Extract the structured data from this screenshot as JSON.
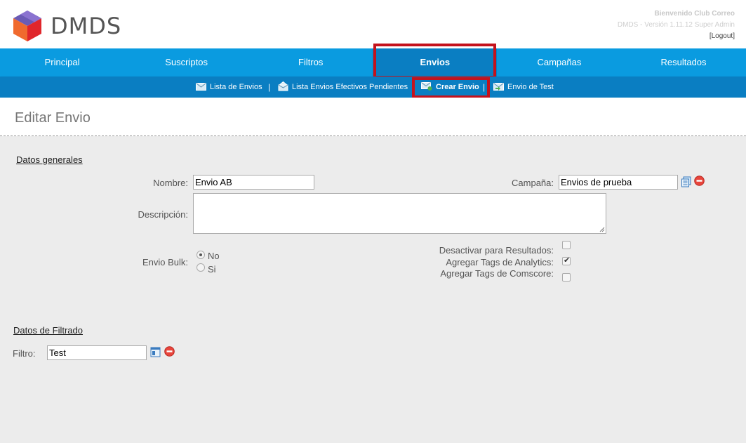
{
  "header": {
    "logo_text": "DMDS",
    "welcome": "Bienvenido Club Correo",
    "version": "DMDS - Versión 1.11.12 Super Admin",
    "logout": "[Logout]"
  },
  "main_nav": {
    "items": [
      {
        "label": "Principal"
      },
      {
        "label": "Suscriptos"
      },
      {
        "label": "Filtros"
      },
      {
        "label": "Envios",
        "active": true
      },
      {
        "label": "Campañas"
      },
      {
        "label": "Resultados"
      }
    ]
  },
  "sub_nav": {
    "items": [
      {
        "label": "Lista de Envios",
        "icon": "envelope-icon"
      },
      {
        "label": "Lista Envios Efectivos Pendientes",
        "icon": "inbox-icon"
      },
      {
        "label": "Crear Envio",
        "icon": "new-envelope-icon",
        "active": true
      },
      {
        "label": "Envio de Test",
        "icon": "test-envelope-icon"
      }
    ],
    "separator": "|"
  },
  "page": {
    "title": "Editar Envio"
  },
  "datos_generales": {
    "section_title": "Datos generales",
    "nombre_label": "Nombre:",
    "nombre_value": "Envio AB",
    "campana_label": "Campaña:",
    "campana_value": "Envios de prueba",
    "descripcion_label": "Descripción:",
    "descripcion_value": "",
    "bulk_label": "Envio Bulk:",
    "bulk_options": [
      {
        "label": "No",
        "checked": true
      },
      {
        "label": "Si",
        "checked": false
      }
    ],
    "checks": [
      {
        "label": "Desactivar para Resultados:",
        "checked": false
      },
      {
        "label": "Agregar Tags de Analytics:",
        "checked": true
      },
      {
        "label": "Agregar Tags de Comscore:",
        "checked": false
      }
    ]
  },
  "datos_filtrado": {
    "section_title": "Datos de Filtrado",
    "filtro_label": "Filtro:",
    "filtro_value": "Test"
  },
  "colors": {
    "nav_blue": "#0a9be0",
    "nav_dark_blue": "#0a7ec2",
    "highlight_red": "#c4121c"
  }
}
